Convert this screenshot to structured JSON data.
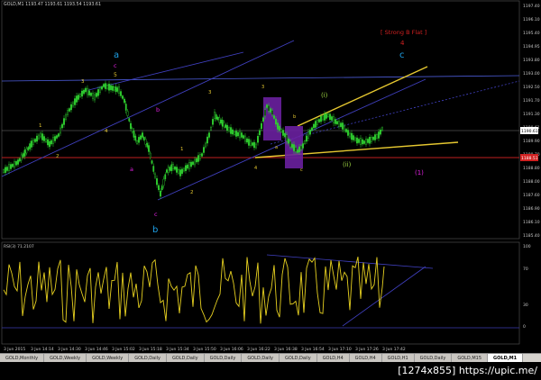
{
  "window": {
    "title": "GOLD,M1 1193.47 1193.61 1193.54 1193.61"
  },
  "rsi_label": "RSI(3) 71.2107",
  "price_axis": [
    "1197.40",
    "1196.10",
    "1195.40",
    "1194.95",
    "1193.80",
    "1193.00",
    "1192.50",
    "1191.70",
    "1191.30",
    "1190.61",
    "1189.90",
    "1189.70",
    "1188.80",
    "1188.00",
    "1187.60",
    "1186.90",
    "1186.10",
    "1185.40"
  ],
  "current_price": "1190.61",
  "red_price": "1188.51",
  "rsi_axis": [
    "100",
    "70",
    "30",
    "0"
  ],
  "time_axis": [
    "3 Jun 2015",
    "3 Jun 14:14",
    "3 Jun 14:30",
    "3 Jun 14:46",
    "3 Jun 15:02",
    "3 Jun 15:18",
    "3 Jun 15:34",
    "3 Jun 15:50",
    "3 Jun 16:06",
    "3 Jun 16:22",
    "3 Jun 16:38",
    "3 Jun 16:54",
    "3 Jun 17:10",
    "3 Jun 17:26",
    "3 Jun 17:42"
  ],
  "wave_labels": {
    "a_big": "a",
    "b_big": "b",
    "c_big": "c",
    "strong_b_flat": "[ Strong B Flat ]",
    "red_4": "4",
    "c_magenta_top": "c",
    "five": "5",
    "three_left": "3",
    "one_left": "1",
    "two_left": "2",
    "four_left": "4",
    "b_magenta": "b",
    "a_magenta": "a",
    "c_magenta_bottom": "c",
    "one_mid": "1",
    "two_mid": "2",
    "three_mid": "3",
    "a_small": "a",
    "b_small": "b",
    "c_small": "c",
    "three_small": "3",
    "four_small": "4",
    "i_label": "(i)",
    "ii_label": "(ii)",
    "one_paren": "(1)"
  },
  "tabs": [
    {
      "label": "GOLD,Monthly"
    },
    {
      "label": "GOLD,Weekly"
    },
    {
      "label": "GOLD,Weekly"
    },
    {
      "label": "GOLD,Daily"
    },
    {
      "label": "GOLD,Daily"
    },
    {
      "label": "GOLD,Daily"
    },
    {
      "label": "GOLD,Daily"
    },
    {
      "label": "GOLD,Daily"
    },
    {
      "label": "GOLD,H4"
    },
    {
      "label": "GOLD,H4"
    },
    {
      "label": "GOLD,H1"
    },
    {
      "label": "GOLD,Daily"
    },
    {
      "label": "GOLD,M15"
    },
    {
      "label": "GOLD,M1"
    }
  ],
  "active_tab_index": 13,
  "watermark": "[1274x855] https://upic.me/",
  "colors": {
    "bullish": "#2fd02f",
    "wave_blue": "#1ea0e6",
    "magenta": "#e020e0",
    "gold": "#e6c830",
    "trend": "#4040c0",
    "red": "#d02020",
    "rsi": "#e6d020"
  }
}
